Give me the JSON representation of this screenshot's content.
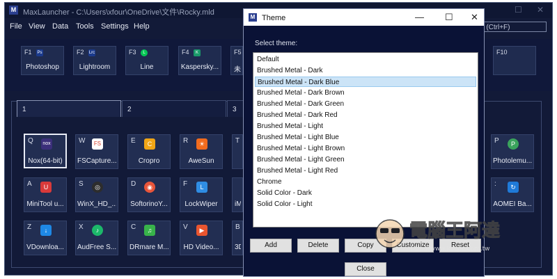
{
  "main": {
    "title": "MaxLauncher - C:\\Users\\xfour\\OneDrive\\文件\\Rocky.mld",
    "menu": [
      "File",
      "View",
      "Data",
      "Tools",
      "Settings",
      "Help"
    ],
    "search_placeholder": "ch (Ctrl+F)",
    "fkeys": [
      {
        "key": "F1",
        "label": "Photoshop",
        "icon": "photoshop-icon",
        "color": "#1b3a8c",
        "glyph": "Ps"
      },
      {
        "key": "F2",
        "label": "Lightroom",
        "icon": "lightroom-icon",
        "color": "#1b3a8c",
        "glyph": "Lrc"
      },
      {
        "key": "F3",
        "label": "Line",
        "icon": "line-icon",
        "color": "#06c755",
        "glyph": "L"
      },
      {
        "key": "F4",
        "label": "Kaspersky...",
        "icon": "kaspersky-icon",
        "color": "#1a9a6a",
        "glyph": "K"
      },
      {
        "key": "F5",
        "label": "未",
        "icon": "",
        "color": "",
        "glyph": ""
      },
      {
        "key": "F10",
        "label": "",
        "icon": "",
        "color": "",
        "glyph": ""
      }
    ],
    "tabs": [
      "1",
      "2",
      "3"
    ],
    "tiles": [
      {
        "key": "Q",
        "label": "Nox(64-bit)",
        "icon": "nox-icon",
        "color": "#3b2f7a",
        "glyph": "nox",
        "selected": true
      },
      {
        "key": "W",
        "label": "FSCapture...",
        "icon": "fscapture-icon",
        "color": "#d8432f",
        "glyph": "FS",
        "selected": false
      },
      {
        "key": "E",
        "label": "Cropro",
        "icon": "cropro-icon",
        "color": "#f0a516",
        "glyph": "C",
        "selected": false
      },
      {
        "key": "R",
        "label": "AweSun",
        "icon": "awesun-icon",
        "color": "#f26b1d",
        "glyph": "☀",
        "selected": false
      },
      {
        "key": "T",
        "label": "",
        "icon": "",
        "color": "",
        "glyph": "",
        "selected": false
      },
      {
        "key": "P",
        "label": "Photolemu...",
        "icon": "photolemur-icon",
        "color": "#3aa35c",
        "glyph": "P",
        "selected": false
      },
      {
        "key": "A",
        "label": "MiniTool u...",
        "icon": "minitool-icon",
        "color": "#d93a3a",
        "glyph": "U",
        "selected": false
      },
      {
        "key": "S",
        "label": "WinX_HD_...",
        "icon": "winx-icon",
        "color": "#2d2d2d",
        "glyph": "◎",
        "selected": false
      },
      {
        "key": "D",
        "label": "SoftorinoY...",
        "icon": "softorino-icon",
        "color": "#e8553a",
        "glyph": "◉",
        "selected": false
      },
      {
        "key": "F",
        "label": "LockWiper",
        "icon": "lockwiper-icon",
        "color": "#2f8de4",
        "glyph": "L",
        "selected": false
      },
      {
        "key": "",
        "label": "iM",
        "icon": "",
        "color": "",
        "glyph": "",
        "selected": false
      },
      {
        "key": ":",
        "label": "AOMEI Ba...",
        "icon": "aomei-icon",
        "color": "#1f7ad8",
        "glyph": "↻",
        "selected": false
      },
      {
        "key": "Z",
        "label": "VDownloa...",
        "icon": "vdownloader-icon",
        "color": "#1e88e5",
        "glyph": "↓",
        "selected": false
      },
      {
        "key": "X",
        "label": "AudFree S...",
        "icon": "audfree-icon",
        "color": "#1cb86a",
        "glyph": "♪",
        "selected": false
      },
      {
        "key": "C",
        "label": "DRmare M...",
        "icon": "drmare-icon",
        "color": "#38b34a",
        "glyph": "♫",
        "selected": false
      },
      {
        "key": "V",
        "label": "HD Video...",
        "icon": "hdvideo-icon",
        "color": "#e9552f",
        "glyph": "▶",
        "selected": false
      },
      {
        "key": "B",
        "label": "3D",
        "icon": "",
        "color": "",
        "glyph": "",
        "selected": false
      }
    ]
  },
  "dialog": {
    "title": "Theme",
    "select_label": "Select theme:",
    "themes": [
      "Default",
      "Brushed Metal - Dark",
      "Brushed Metal - Dark Blue",
      "Brushed Metal - Dark Brown",
      "Brushed Metal - Dark Green",
      "Brushed Metal - Dark Red",
      "Brushed Metal - Light",
      "Brushed Metal - Light Blue",
      "Brushed Metal - Light Brown",
      "Brushed Metal - Light Green",
      "Brushed Metal - Light Red",
      "Chrome",
      "Solid Color - Dark",
      "Solid Color - Light"
    ],
    "selected_index": 2,
    "buttons": {
      "add": "Add",
      "delete": "Delete",
      "copy": "Copy",
      "customize": "Customize",
      "reset": "Reset",
      "close": "Close"
    }
  },
  "watermark": {
    "text": "電腦王阿達",
    "url": "http://www.kocpc.com.tw"
  },
  "colors": {
    "main_bg": "#121a38",
    "tile_bg": "#222e52",
    "selection": "#cce4f7"
  }
}
